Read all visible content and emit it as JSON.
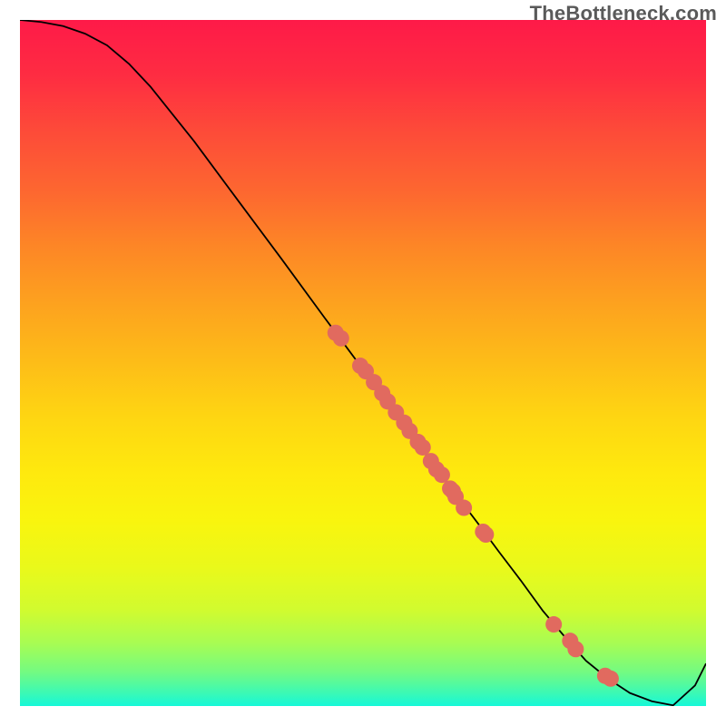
{
  "watermark": "TheBottleneck.com",
  "colors": {
    "curve": "#000000",
    "dot": "#e16a5f",
    "gradient_top": "#fe1a48",
    "gradient_bottom": "#16f8d8"
  },
  "chart_data": {
    "type": "line",
    "title": "",
    "xlabel": "",
    "ylabel": "",
    "xlim": [
      0,
      100
    ],
    "ylim": [
      0,
      100
    ],
    "curve": {
      "x": [
        0,
        3.1,
        6.3,
        9.5,
        12.7,
        15.9,
        19.0,
        25.4,
        31.7,
        38.1,
        44.4,
        50.8,
        57.1,
        60.3,
        63.5,
        66.7,
        69.8,
        73.0,
        76.2,
        79.4,
        82.5,
        85.7,
        88.9,
        92.1,
        95.2,
        98.4,
        100
      ],
      "y": [
        100,
        99.7,
        99.1,
        98.0,
        96.3,
        93.6,
        90.3,
        82.3,
        73.8,
        65.2,
        56.6,
        48.0,
        39.4,
        35.2,
        30.9,
        26.7,
        22.5,
        18.3,
        13.9,
        10.1,
        6.6,
        4.0,
        1.9,
        0.7,
        0.1,
        3.0,
        6.2
      ]
    },
    "series": [
      {
        "name": "data-points",
        "x": [
          46.0,
          46.8,
          49.6,
          50.4,
          51.6,
          52.8,
          53.6,
          54.8,
          56.0,
          56.8,
          58.0,
          58.7,
          59.9,
          60.7,
          61.5,
          62.7,
          63.1,
          63.5,
          64.7,
          67.5,
          67.9,
          77.8,
          80.2,
          81.0,
          85.3,
          86.1
        ],
        "y": [
          54.4,
          53.6,
          49.6,
          48.8,
          47.2,
          45.6,
          44.4,
          42.8,
          41.3,
          40.1,
          38.5,
          37.7,
          35.7,
          34.5,
          33.7,
          31.7,
          31.3,
          30.5,
          28.9,
          25.4,
          25.0,
          11.9,
          9.5,
          8.3,
          4.4,
          4.0
        ]
      }
    ]
  }
}
